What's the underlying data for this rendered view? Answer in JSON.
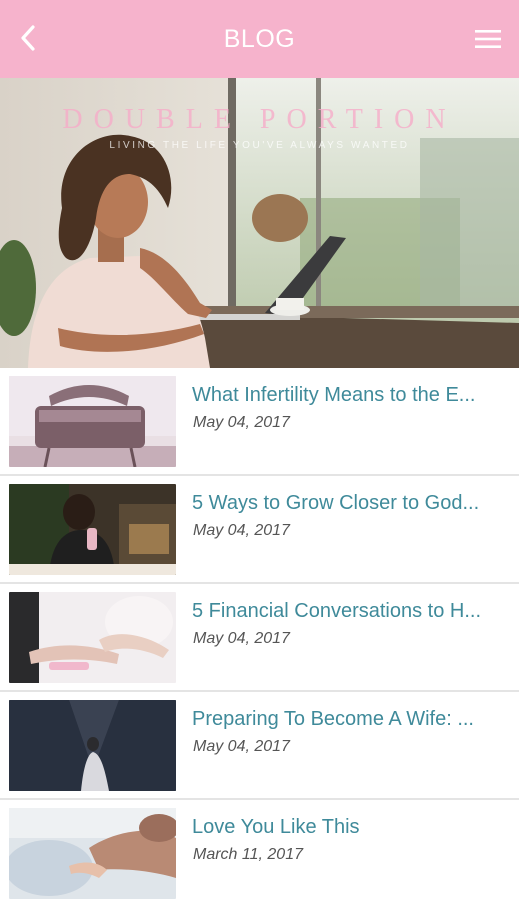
{
  "header": {
    "title": "BLOG",
    "back_icon": "chevron-left-icon",
    "menu_icon": "hamburger-menu-icon",
    "background_color": "#f6b3cc"
  },
  "hero": {
    "brand": "DOUBLE PORTION",
    "tagline": "LIVING THE LIFE YOU'VE ALWAYS WANTED"
  },
  "posts": [
    {
      "title": "What Infertility Means to the E...",
      "date": "May 04, 2017",
      "thumb": "bassinet-photo"
    },
    {
      "title": "5 Ways to Grow Closer to God...",
      "date": "May 04, 2017",
      "thumb": "couple-drinks-photo"
    },
    {
      "title": "5 Financial Conversations to H...",
      "date": "May 04, 2017",
      "thumb": "hands-holding-photo"
    },
    {
      "title": "Preparing To Become A Wife: ...",
      "date": "May 04, 2017",
      "thumb": "bride-silhouette-photo"
    },
    {
      "title": "Love You Like This",
      "date": "March 11, 2017",
      "thumb": "baby-hands-photo"
    }
  ],
  "colors": {
    "title_text": "#3f8a9a",
    "date_text": "#555555",
    "divider": "#e4e4e4"
  }
}
